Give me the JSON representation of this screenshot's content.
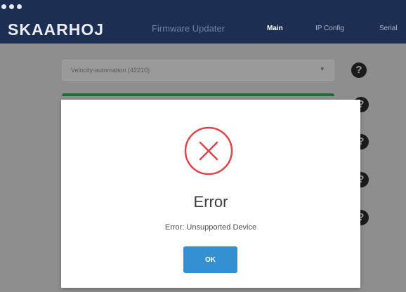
{
  "window": {
    "dot_count": 3
  },
  "header": {
    "brand": "SKAARHOJ",
    "app_name": "Firmware Updater",
    "tabs": [
      {
        "label": "Main",
        "active": true
      },
      {
        "label": "IP Config",
        "active": false
      },
      {
        "label": "Serial",
        "active": false
      }
    ]
  },
  "main": {
    "device_select": {
      "value": "Velocity-automation (42210)"
    },
    "help_glyph": "?"
  },
  "modal": {
    "icon": "error-circle-x-icon",
    "title": "Error",
    "message": "Error: Unsupported Device",
    "ok_label": "OK"
  },
  "colors": {
    "header_bg": "#1c2e52",
    "overlay_bg": "#8e8e8e",
    "error_red": "#e0454b",
    "button_blue": "#3590d2",
    "progress_green": "#1f6f32"
  }
}
